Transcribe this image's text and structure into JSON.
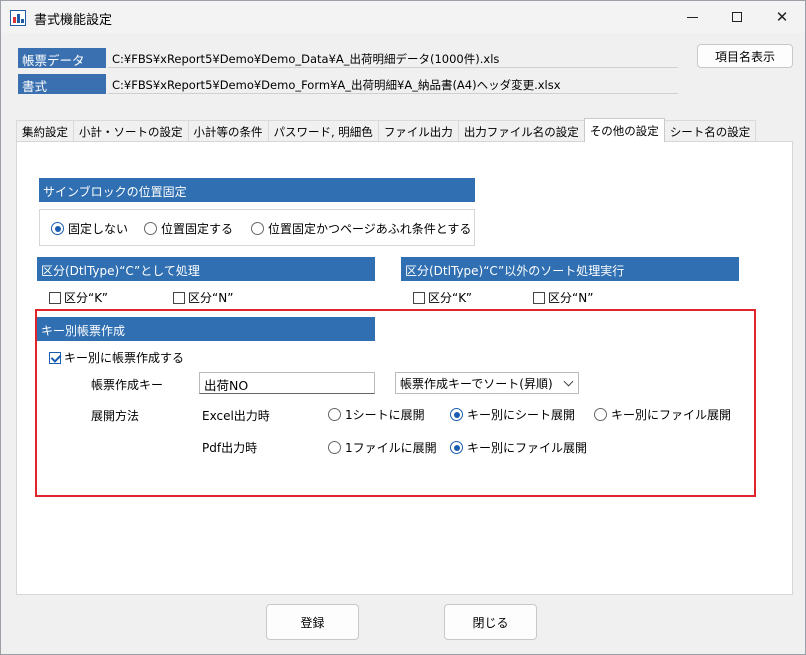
{
  "window": {
    "title": "書式機能設定"
  },
  "paths": {
    "data_label": "帳票データ",
    "data_value": "C:¥FBS¥xReport5¥Demo¥Demo_Data¥A_出荷明細データ(1000件).xls",
    "form_label": "書式",
    "form_value": "C:¥FBS¥xReport5¥Demo¥Demo_Form¥A_出荷明細¥A_納品書(A4)ヘッダ変更.xlsx"
  },
  "buttons": {
    "show_item_names": "項目名表示",
    "register": "登録",
    "close": "閉じる"
  },
  "tabs": [
    {
      "label": "集約設定"
    },
    {
      "label": "小計・ソートの設定"
    },
    {
      "label": "小計等の条件"
    },
    {
      "label": "パスワード, 明細色"
    },
    {
      "label": "ファイル出力"
    },
    {
      "label": "出力ファイル名の設定"
    },
    {
      "label": "その他の設定"
    },
    {
      "label": "シート名の設定"
    }
  ],
  "active_tab_index": 6,
  "sign_block": {
    "header": "サインブロックの位置固定",
    "options": [
      "固定しない",
      "位置固定する",
      "位置固定かつページあふれ条件とする"
    ],
    "selected": "固定しない"
  },
  "dtl_c": {
    "header": "区分(DtlType)“C”として処理",
    "check_k": "区分“K”",
    "check_n": "区分“N”"
  },
  "dtl_other": {
    "header": "区分(DtlType)“C”以外のソート処理実行",
    "check_k": "区分“K”",
    "check_n": "区分“N”"
  },
  "key_report": {
    "header": "キー別帳票作成",
    "enable_label": "キー別に帳票作成する",
    "enabled": true,
    "key_label": "帳票作成キー",
    "key_value": "出荷NO",
    "sort_select": "帳票作成キーでソート(昇順)",
    "expand_label": "展開方法",
    "excel_label": "Excel出力時",
    "excel_options": [
      "1シートに展開",
      "キー別にシート展開",
      "キー別にファイル展開"
    ],
    "excel_selected": "キー別にシート展開",
    "pdf_label": "Pdf出力時",
    "pdf_options": [
      "1ファイルに展開",
      "キー別にファイル展開"
    ],
    "pdf_selected": "キー別にファイル展開"
  },
  "colors": {
    "section_header": "#2f6fb2",
    "highlight_border": "#e0242c",
    "accent": "#1a5cb0"
  }
}
